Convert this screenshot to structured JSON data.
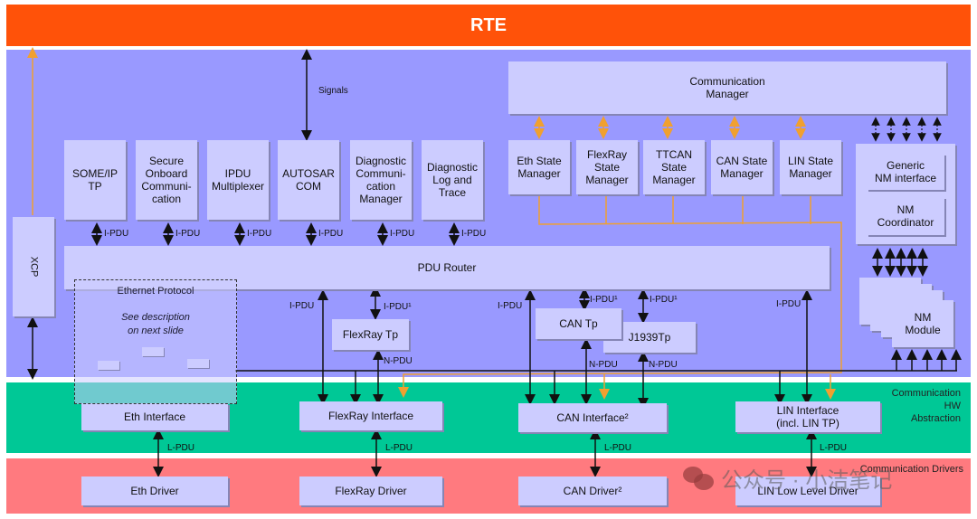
{
  "layers": {
    "rte": "RTE",
    "hw_abstraction": "Communication\nHW\nAbstraction",
    "drivers": "Communication Drivers"
  },
  "services": {
    "signals_label": "Signals",
    "com_manager": "Communication\nManager",
    "upper_modules": [
      "SOME/IP\nTP",
      "Secure\nOnboard\nCommuni-\ncation",
      "IPDU\nMultiplexer",
      "AUTOSAR\nCOM",
      "Diagnostic\nCommuni-\ncation\nManager",
      "Diagnostic\nLog and\nTrace"
    ],
    "ipdu_label": "I-PDU",
    "state_managers": [
      "Eth State\nManager",
      "FlexRay\nState\nManager",
      "TTCAN\nState\nManager",
      "CAN State\nManager",
      "LIN State\nManager"
    ],
    "generic_nm": "Generic\nNM interface",
    "nm_coordinator": "NM\nCoordinator",
    "nm_module": "NM\nModule",
    "xcp": "XCP",
    "pdu_router": "PDU Router",
    "ethernet_protocol": {
      "title": "Ethernet Protocol",
      "description": "See description\non next slide"
    },
    "flexray_tp": "FlexRay Tp",
    "can_tp": "CAN Tp",
    "j1939tp": "J1939Tp",
    "ipdu1_label": "I-PDU¹",
    "npdu_label": "N-PDU"
  },
  "hw_abstraction": {
    "eth_interface": "Eth Interface",
    "flexray_interface": "FlexRay Interface",
    "can_interface": "CAN Interface²",
    "lin_interface": "LIN Interface\n(incl. LIN TP)",
    "lpdu_label": "L-PDU"
  },
  "drivers": {
    "eth_driver": "Eth Driver",
    "flexray_driver": "FlexRay Driver",
    "can_driver": "CAN Driver²",
    "lin_driver": "LIN Low Level Driver"
  },
  "watermark": "公众号 · 小洁笔记",
  "colors": {
    "rte": "#ff5209",
    "services": "#9999ff",
    "hw_abstraction": "#00c896",
    "drivers": "#ff7a7f",
    "module": "#ccccff",
    "mode_line": "#f0a030"
  }
}
